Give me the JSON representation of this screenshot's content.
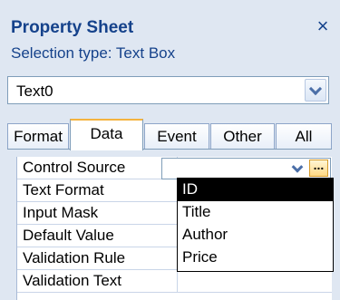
{
  "panel": {
    "title": "Property Sheet",
    "selection_type": "Selection type:  Text Box",
    "close_symbol": "×"
  },
  "object_selector": {
    "value": "Text0"
  },
  "tabs": [
    {
      "label": "Format",
      "active": false
    },
    {
      "label": "Data",
      "active": true
    },
    {
      "label": "Event",
      "active": false
    },
    {
      "label": "Other",
      "active": false
    },
    {
      "label": "All",
      "active": false
    }
  ],
  "properties": [
    {
      "name": "Control Source"
    },
    {
      "name": "Text Format"
    },
    {
      "name": "Input Mask"
    },
    {
      "name": "Default Value"
    },
    {
      "name": "Validation Rule"
    },
    {
      "name": "Validation Text"
    }
  ],
  "control_source": {
    "value": "",
    "builder_label": "..."
  },
  "dropdown": {
    "options": [
      "ID",
      "Title",
      "Author",
      "Price"
    ],
    "selected": "ID"
  },
  "colors": {
    "panel_bg": "#dfe7f2",
    "header_text": "#15428b",
    "active_tab_accent": "#f4b33f",
    "selected_option_bg": "#000000"
  }
}
